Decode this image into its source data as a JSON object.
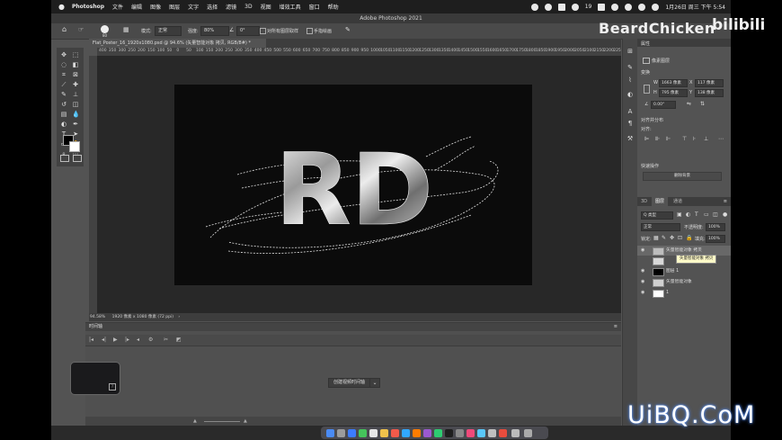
{
  "menubar": {
    "apple": "",
    "app_name": "Photoshop",
    "items": [
      "文件",
      "编辑",
      "图像",
      "图层",
      "文字",
      "选择",
      "滤镜",
      "3D",
      "视图",
      "增效工具",
      "窗口",
      "帮助"
    ],
    "clock": "1月26日 周三 下午 5:54",
    "battery": "19"
  },
  "window_title": "Adobe Photoshop 2021",
  "options_bar": {
    "brush_size": "80",
    "mode_label": "模式:",
    "mode_value": "正常",
    "opacity_label": "强度:",
    "opacity_value": "80%",
    "angle_label": "",
    "angle_value": "0°",
    "sample_all_layers": "对所有图层取样",
    "finger_painting": "手指绘画"
  },
  "document": {
    "tab_label": "Flat_Poster_16_1920x1080.psd @ 94.6% (矢量智能对象 拷贝, RGB/8#) *",
    "zoom": "94.58%",
    "info": "1920 像素 x 1080 像素 (72 ppi)",
    "artwork_text": "RD"
  },
  "ruler": {
    "ticks": [
      "400",
      "350",
      "300",
      "250",
      "200",
      "150",
      "100",
      "50",
      "0",
      "50",
      "100",
      "150",
      "200",
      "250",
      "300",
      "350",
      "400",
      "450",
      "500",
      "550",
      "600",
      "650",
      "700",
      "750",
      "800",
      "850",
      "900",
      "950",
      "1000",
      "1050",
      "1100",
      "1150",
      "1200",
      "1250",
      "1300",
      "1350",
      "1400",
      "1450",
      "1500",
      "1550",
      "1600",
      "1650",
      "1700",
      "1750",
      "1800",
      "1850",
      "1900",
      "1950",
      "2000",
      "2050",
      "2100",
      "2150",
      "2200",
      "2250"
    ]
  },
  "timeline": {
    "title": "时间轴",
    "create_button": "创建视频时间轴"
  },
  "properties": {
    "title": "属性",
    "layer_type": "像素图层",
    "transform_title": "变换",
    "w_label": "W",
    "w_value": "1663 像素",
    "h_label": "H",
    "h_value": "795 像素",
    "x_label": "X",
    "x_value": "117 像素",
    "y_label": "Y",
    "y_value": "138 像素",
    "angle_value": "0.00°",
    "align_title": "对齐并分布",
    "align_label": "对齐:",
    "quick_title": "快速操作",
    "remove_bg": "删除背景"
  },
  "layers_panel": {
    "tabs": [
      "3D",
      "图层",
      "通道"
    ],
    "active_tab": "图层",
    "filter_label": "Q 类型",
    "blend_mode": "正常",
    "opacity_label": "不透明度:",
    "opacity_value": "100%",
    "lock_label": "锁定:",
    "fill_label": "填充:",
    "fill_value": "100%",
    "layers": [
      {
        "name": "矢量智能对象 拷贝",
        "selected": true
      },
      {
        "name": "",
        "selected": false
      },
      {
        "name": "图层 1",
        "selected": false
      },
      {
        "name": "矢量智能对象",
        "selected": false
      },
      {
        "name": "1",
        "selected": false
      }
    ],
    "tooltip": "矢量智能对象 拷贝"
  },
  "watermarks": {
    "beardchicken": "BeardChicken",
    "bilibili": "bilibili",
    "uibq": "UiBQ.CoM"
  }
}
